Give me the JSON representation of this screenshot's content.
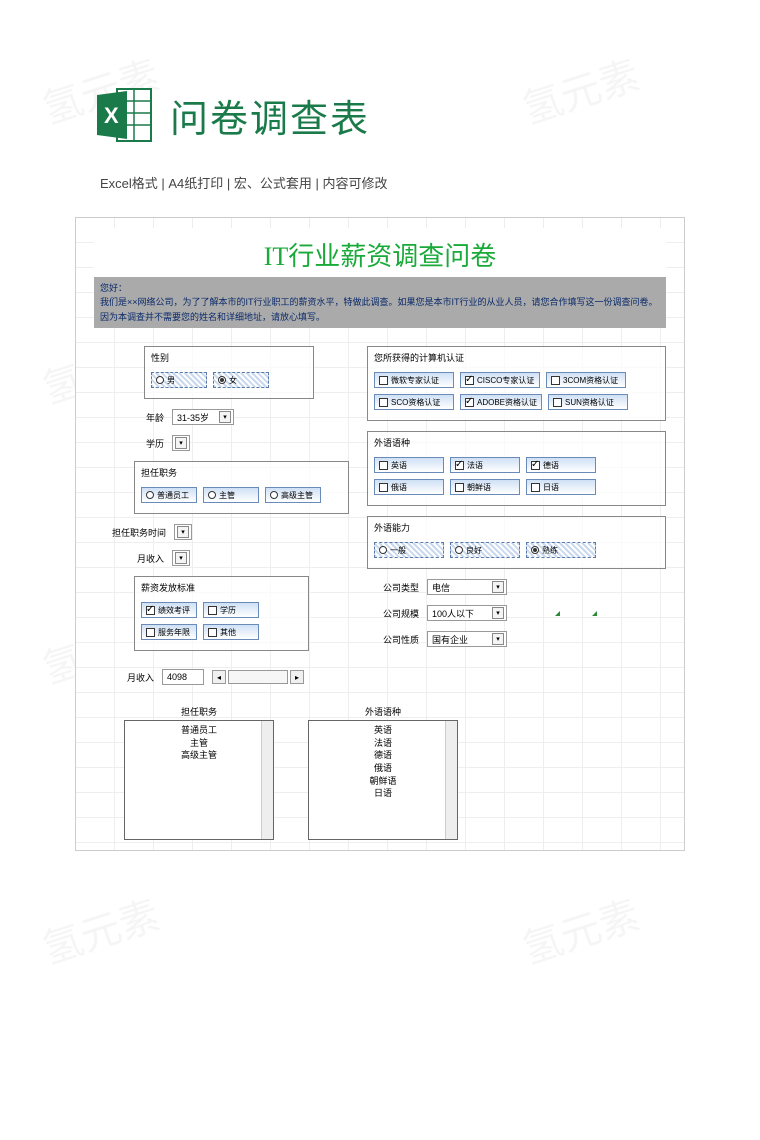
{
  "header": {
    "title": "问卷调查表",
    "sub": "Excel格式 |  A4纸打印 | 宏、公式套用 | 内容可修改"
  },
  "doc": {
    "title": "IT行业薪资调查问卷",
    "intro_greeting": "您好：",
    "intro_line1": "    我们是××网络公司，为了了解本市的IT行业职工的薪资水平，特做此调查。如果您是本市IT行业的从业人员，请您合作填写这一份调查问卷。",
    "intro_line2": "    因为本调查并不需要您的姓名和详细地址，请放心填写。"
  },
  "gender": {
    "title": "性别",
    "opt_male": "男",
    "opt_female": "女"
  },
  "age": {
    "label": "年龄",
    "value": "31-35岁"
  },
  "edu": {
    "label": "学历"
  },
  "position": {
    "title": "担任职务",
    "opt1": "普通员工",
    "opt2": "主管",
    "opt3": "高级主管"
  },
  "tenure": {
    "label": "担任职务时间"
  },
  "monthly": {
    "label": "月收入"
  },
  "salary_std": {
    "title": "薪资发放标准",
    "opt1": "绩效考评",
    "opt2": "学历",
    "opt3": "服务年限",
    "opt4": "其他"
  },
  "income2": {
    "label": "月收入",
    "value": "4098"
  },
  "cert": {
    "title": "您所获得的计算机认证",
    "opt1": "微软专家认证",
    "opt2": "CISCO专家认证",
    "opt3": "3COM资格认证",
    "opt4": "SCO资格认证",
    "opt5": "ADOBE资格认证",
    "opt6": "SUN资格认证"
  },
  "lang": {
    "title": "外语语种",
    "opt1": "英语",
    "opt2": "法语",
    "opt3": "德语",
    "opt4": "俄语",
    "opt5": "朝鲜语",
    "opt6": "日语"
  },
  "lang_skill": {
    "title": "外语能力",
    "opt1": "一般",
    "opt2": "良好",
    "opt3": "熟练"
  },
  "co_type": {
    "label": "公司类型",
    "value": "电信"
  },
  "co_size": {
    "label": "公司规模",
    "value": "100人以下"
  },
  "co_nature": {
    "label": "公司性质",
    "value": "国有企业"
  },
  "listboxes": {
    "pos_title": "担任职务",
    "pos_items": [
      "普通员工",
      "主管",
      "高级主管"
    ],
    "lang_title": "外语语种",
    "lang_items": [
      "英语",
      "法语",
      "德语",
      "俄语",
      "朝鲜语",
      "日语"
    ]
  },
  "watermark": "氢元素"
}
